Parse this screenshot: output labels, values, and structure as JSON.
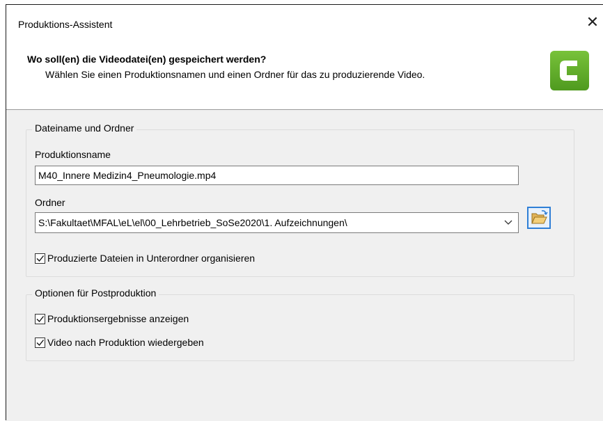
{
  "window": {
    "title": "Produktions-Assistent",
    "close_symbol": "✕"
  },
  "header": {
    "title": "Wo soll(en) die Videodatei(en) gespeichert werden?",
    "subtitle": "Wählen Sie einen Produktionsnamen und einen Ordner für das zu produzierende Video.",
    "logo_icon": "camtasia-logo-icon",
    "logo_color": "#5aa82a"
  },
  "file_group": {
    "legend": "Dateiname und Ordner",
    "name_label": "Produktionsname",
    "name_value": "M40_Innere Medizin4_Pneumologie.mp4",
    "folder_label": "Ordner",
    "folder_value": "S:\\Fakultaet\\MFAL\\eL\\el\\00_Lehrbetrieb_SoSe2020\\1. Aufzeichnungen\\",
    "browse_icon": "open-folder-icon",
    "organize_label": "Produzierte Dateien in Unterordner organisieren",
    "organize_checked": true
  },
  "post_group": {
    "legend": "Optionen für Postproduktion",
    "show_results_label": "Produktionsergebnisse anzeigen",
    "show_results_checked": true,
    "play_video_label": "Video nach Produktion wiedergeben",
    "play_video_checked": true
  },
  "colors": {
    "accent": "#2f7fd6",
    "panel_bg": "#f0f0f0"
  }
}
